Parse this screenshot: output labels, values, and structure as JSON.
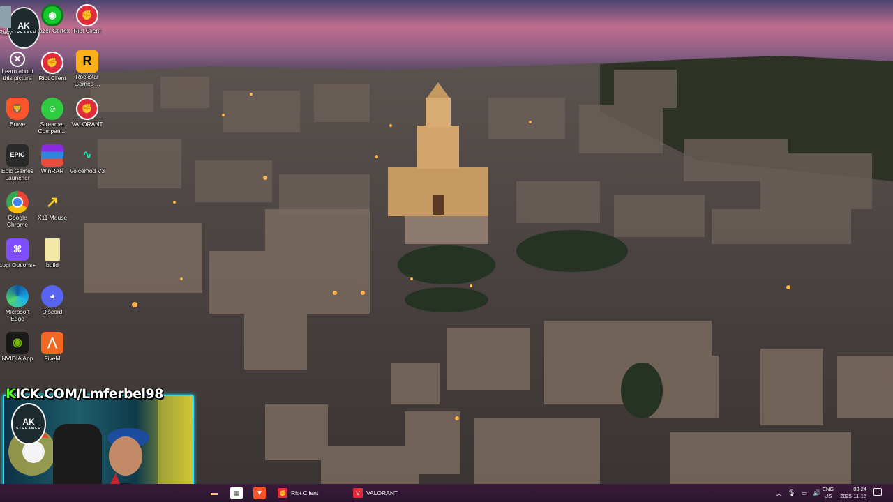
{
  "desktop": {
    "icons": [
      {
        "label": "Recycle Bin",
        "icon": "recycle-bin-icon"
      },
      {
        "label": "Razer Cortex",
        "icon": "razer-cortex-icon"
      },
      {
        "label": "Riot Client",
        "icon": "riot-client-icon"
      },
      {
        "label": "Learn about this picture",
        "icon": "learn-about-picture-icon"
      },
      {
        "label": "Riot Client",
        "icon": "riot-client-icon"
      },
      {
        "label": "Rockstar Games ...",
        "icon": "rockstar-games-icon"
      },
      {
        "label": "Brave",
        "icon": "brave-icon"
      },
      {
        "label": "Streamer Compani...",
        "icon": "streamer-companion-icon"
      },
      {
        "label": "VALORANT",
        "icon": "valorant-icon"
      },
      {
        "label": "Epic Games Launcher",
        "icon": "epic-games-icon"
      },
      {
        "label": "WinRAR",
        "icon": "winrar-icon"
      },
      {
        "label": "Voicemod V3",
        "icon": "voicemod-icon"
      },
      {
        "label": "Google Chrome",
        "icon": "chrome-icon"
      },
      {
        "label": "X11 Mouse",
        "icon": "x11-mouse-icon"
      },
      {
        "label": "Logi Options+",
        "icon": "logi-options-icon"
      },
      {
        "label": "build",
        "icon": "folder-icon"
      },
      {
        "label": "Microsoft Edge",
        "icon": "edge-icon"
      },
      {
        "label": "Discord",
        "icon": "discord-icon"
      },
      {
        "label": "NVIDIA App",
        "icon": "nvidia-icon"
      },
      {
        "label": "FiveM",
        "icon": "fivem-icon"
      }
    ],
    "epic_glyph": "EPIC",
    "rockstar_glyph": "R"
  },
  "overlay": {
    "kick_prefix": "K",
    "kick_rest": "ICK.COM/Lmferbel98",
    "channel_logo_text": "AK",
    "channel_logo_sub": "STREAMER",
    "cam_logo_text": "AK",
    "cam_logo_sub": "STREAMER"
  },
  "taskbar": {
    "apps": [
      {
        "label": "Riot Client",
        "icon": "riot-client-icon"
      },
      {
        "label": "VALORANT",
        "icon": "valorant-icon"
      }
    ],
    "language_top": "ENG",
    "language_bottom": "US",
    "time": "03:24",
    "date": "2025-11-18"
  },
  "colors": {
    "taskbar_bg": "#2c1530",
    "kick_green": "#53fc18",
    "webcam_border": "#1ce3ff",
    "riot_red": "#e02b3a"
  }
}
